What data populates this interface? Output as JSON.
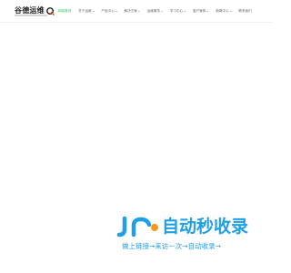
{
  "header": {
    "logo_text": "谷德运维",
    "nav": [
      {
        "label": "网站首页",
        "has_dropdown": false,
        "active": true
      },
      {
        "label": "关于运维",
        "has_dropdown": true,
        "active": false
      },
      {
        "label": "产品中心",
        "has_dropdown": true,
        "active": false
      },
      {
        "label": "解决方案",
        "has_dropdown": true,
        "active": false
      },
      {
        "label": "运维服务",
        "has_dropdown": true,
        "active": false
      },
      {
        "label": "学习中心",
        "has_dropdown": true,
        "active": false
      },
      {
        "label": "客户案例",
        "has_dropdown": true,
        "active": false
      },
      {
        "label": "新闻中心",
        "has_dropdown": true,
        "active": false
      },
      {
        "label": "联系我们",
        "has_dropdown": false,
        "active": false
      }
    ]
  },
  "watermark": {
    "title": "自动秒收录",
    "slogan": "做上链接→来访一次→自动收录→"
  },
  "colors": {
    "nav_active": "#2db84d",
    "nav_text": "#666666",
    "brand_blue": "#1f9fe6",
    "brand_orange": "#f39a1e"
  }
}
